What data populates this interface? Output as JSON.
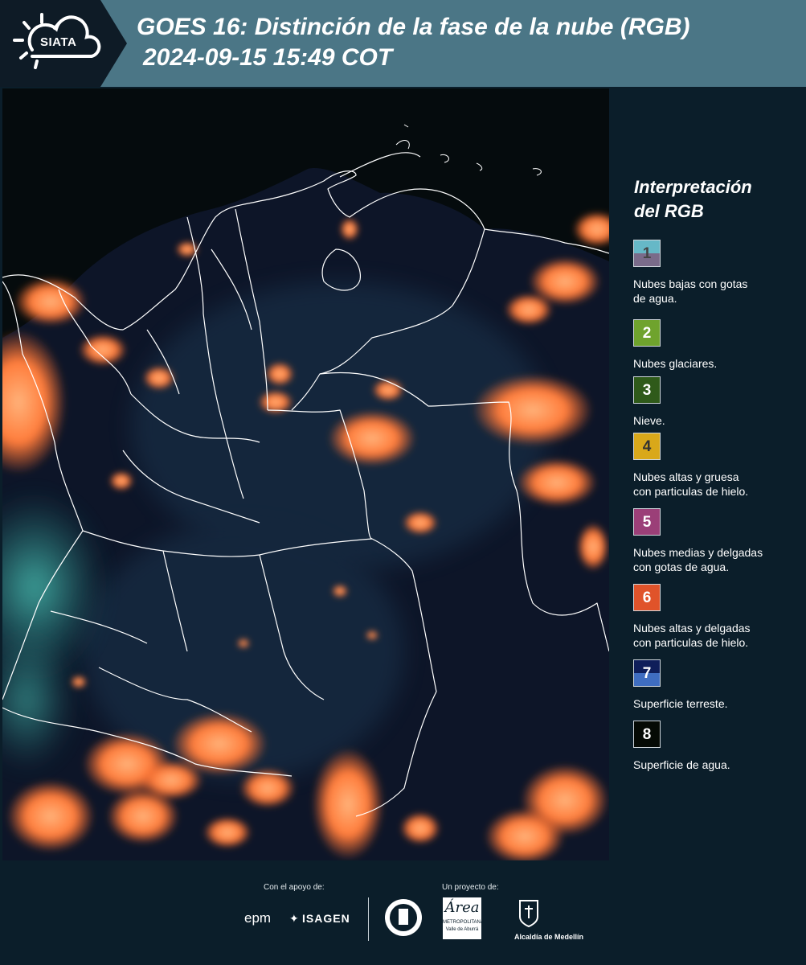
{
  "header": {
    "logo_text": "SIATA",
    "title": "GOES 16: Distinción de la fase de la nube (RGB)",
    "subtitle": "2024-09-15 15:49 COT"
  },
  "legend": {
    "title_line1": "Interpretación",
    "title_line2": "del RGB",
    "items": [
      {
        "number": "1",
        "label_line1": "Nubes bajas con gotas",
        "label_line2": "de agua.",
        "color_top": "#66b8c7",
        "color_bottom": "#7a6b8a",
        "num_color": "#444444"
      },
      {
        "number": "2",
        "label_line1": "Nubes glaciares.",
        "label_line2": "",
        "color_top": "#6fa32d",
        "color_bottom": "#6fa32d",
        "num_color": "#ffffff"
      },
      {
        "number": "3",
        "label_line1": "Nieve.",
        "label_line2": "",
        "color_top": "#2f5a1a",
        "color_bottom": "#2f5a1a",
        "num_color": "#ffffff"
      },
      {
        "number": "4",
        "label_line1": "Nubes altas y gruesa",
        "label_line2": "con particulas de hielo.",
        "color_top": "#d9a81a",
        "color_bottom": "#d9a81a",
        "num_color": "#333333"
      },
      {
        "number": "5",
        "label_line1": "Nubes medias y delgadas",
        "label_line2": "con gotas de agua.",
        "color_top": "#9b3f78",
        "color_bottom": "#9b3f78",
        "num_color": "#ffffff"
      },
      {
        "number": "6",
        "label_line1": "Nubes altas y delgadas",
        "label_line2": "con particulas de hielo.",
        "color_top": "#e0532a",
        "color_bottom": "#e0532a",
        "num_color": "#ffffff"
      },
      {
        "number": "7",
        "label_line1": "Superficie terreste.",
        "label_line2": "",
        "color_top": "#0f1e5a",
        "color_bottom": "#3f6dc0",
        "num_color": "#ffffff"
      },
      {
        "number": "8",
        "label_line1": "Superficie de agua.",
        "label_line2": "",
        "color_top": "#050a05",
        "color_bottom": "#050a05",
        "num_color": "#ffffff"
      }
    ]
  },
  "footer": {
    "support_label": "Con el apoyo de:",
    "project_label": "Un proyecto de:",
    "sponsor1": "epm",
    "sponsor2": "ISAGEN",
    "partner_area_line1": "Área",
    "partner_area_line2": "METROPOLITANA",
    "partner_area_line3": "Valle de Aburrá",
    "partner_alcaldia": "Alcaldía de Medellín"
  },
  "colors": {
    "header_band": "#4b7686",
    "background": "#0b1e2a",
    "cloud_orange": "#ff7a3a",
    "boundary_white": "#ffffff"
  }
}
